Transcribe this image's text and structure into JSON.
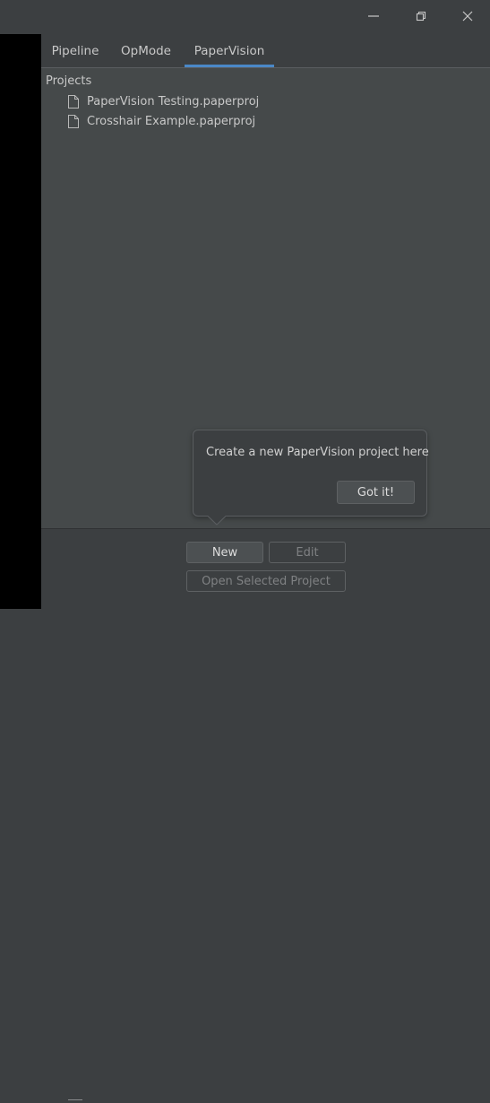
{
  "window": {
    "controls": [
      {
        "name": "minimize-icon"
      },
      {
        "name": "restore-icon"
      },
      {
        "name": "close-icon"
      }
    ]
  },
  "tabs": [
    {
      "label": "Pipeline",
      "active": false
    },
    {
      "label": "OpMode",
      "active": false
    },
    {
      "label": "PaperVision",
      "active": true
    }
  ],
  "projects": {
    "label": "Projects",
    "files": [
      {
        "name": "PaperVision Testing.paperproj",
        "icon": "file-icon"
      },
      {
        "name": "Crosshair Example.paperproj",
        "icon": "file-icon"
      }
    ]
  },
  "tooltip": {
    "text": "Create a new PaperVision project here",
    "button_label": "Got it!"
  },
  "actions": {
    "new_label": "New",
    "edit_label": "Edit",
    "open_label": "Open Selected Project"
  },
  "colors": {
    "accent": "#4a88c7",
    "panel_bg": "#45494a",
    "chrome_bg": "#3c3f41"
  }
}
